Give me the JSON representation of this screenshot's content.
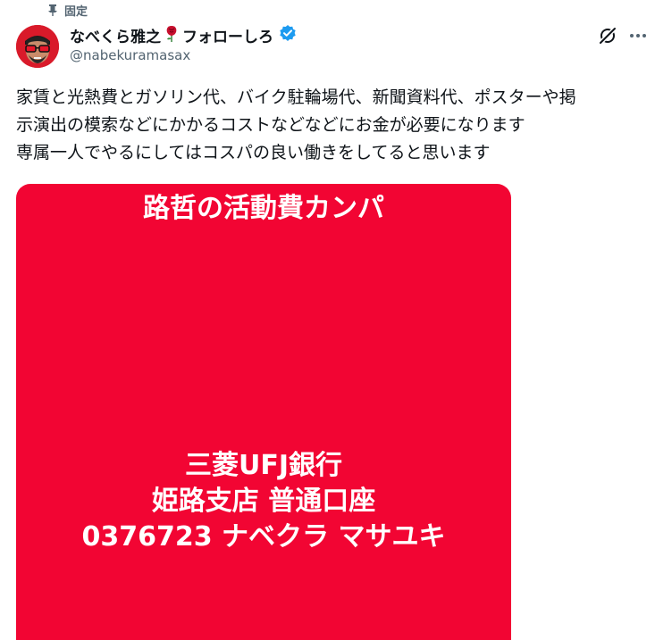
{
  "pinned": {
    "label": "固定"
  },
  "author": {
    "name": "なべくら雅之",
    "name_suffix": "フォローしろ",
    "handle": "@nabekuramasax",
    "verified_color": "#1d9bf0"
  },
  "post": {
    "lines": [
      "家賃と光熱費とガソリン代、バイク駐輪場代、新聞資料代、ポスターや掲",
      "示演出の模索などにかかるコストなどなどにお金が必要になります",
      "専属一人でやるにしてはコスパの良い働きをしてると思います"
    ]
  },
  "media": {
    "background": "#f20533",
    "title": "路哲の活動費カンパ",
    "bank_lines": [
      "三菱UFJ銀行",
      "姫路支店 普通口座",
      "0376723 ナベクラ マサユキ"
    ]
  },
  "icons": {
    "pin": "pin-icon",
    "rose": "rose-icon",
    "verified": "verified-badge-icon",
    "grok": "grok-icon",
    "more": "more-options-icon"
  }
}
